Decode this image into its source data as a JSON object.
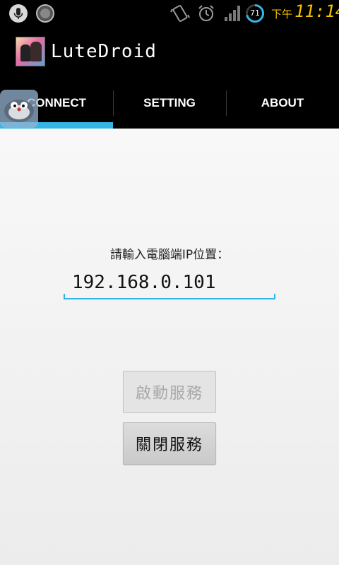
{
  "status_bar": {
    "clock_prefix": "下午",
    "clock_time": "11:14",
    "battery_level": "71",
    "colors": {
      "clock": "#f2c200",
      "battery_ring": "#33b5e5"
    },
    "icons": [
      "mic-icon",
      "circle-app-icon",
      "vibrate-icon",
      "alarm-icon",
      "signal-icon",
      "battery-icon"
    ]
  },
  "action_bar": {
    "title": "LuteDroid"
  },
  "tabs": [
    {
      "label": "CONNECT",
      "selected": true
    },
    {
      "label": "SETTING",
      "selected": false
    },
    {
      "label": "ABOUT",
      "selected": false
    }
  ],
  "connect": {
    "ip_label": "請輸入電腦端IP位置：",
    "ip_value": "192.168.0.101",
    "start_button": "啟動服務",
    "start_button_enabled": false,
    "stop_button": "關閉服務",
    "stop_button_enabled": true
  },
  "colors": {
    "accent": "#33b5e5",
    "background": "#f2f2f2"
  }
}
